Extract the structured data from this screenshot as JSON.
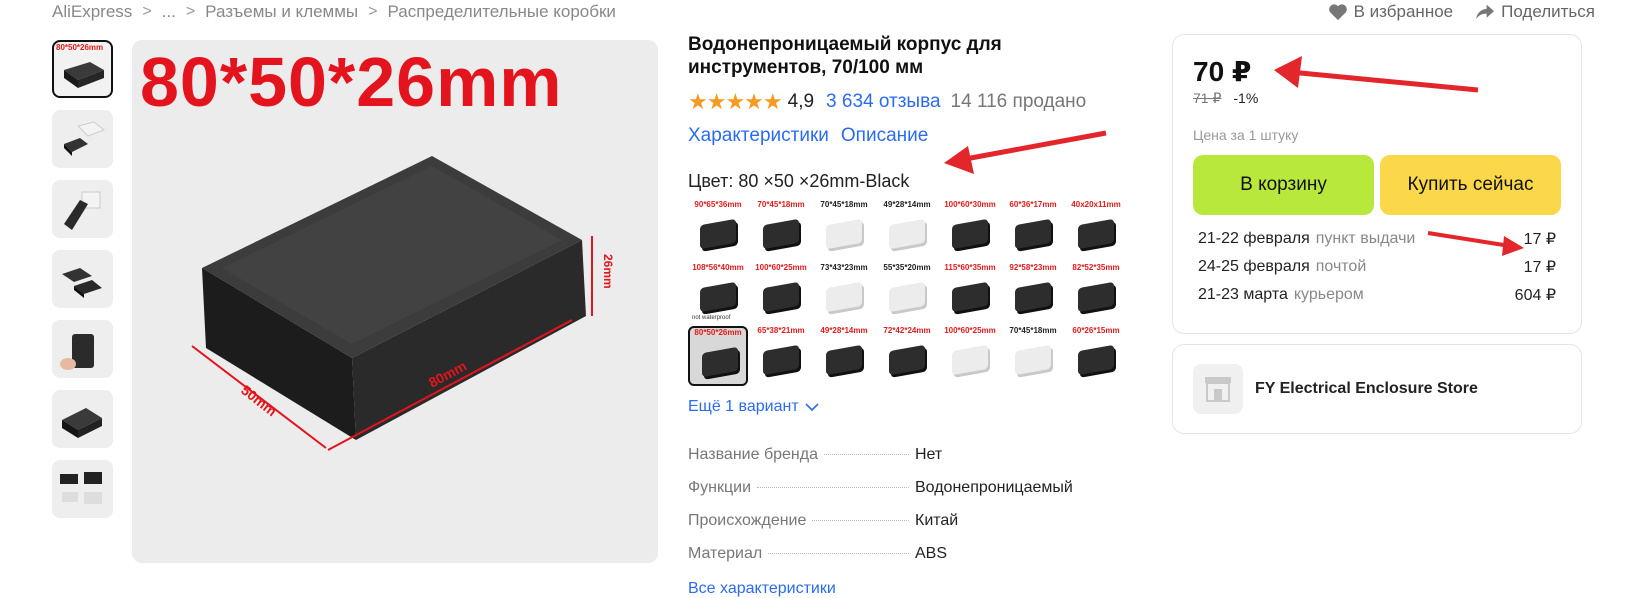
{
  "breadcrumb": {
    "items": [
      "AliExpress",
      "...",
      "Разъемы и клеммы",
      "Распределительные коробки"
    ]
  },
  "top_actions": {
    "favorite": "В избранное",
    "share": "Поделиться"
  },
  "gallery": {
    "main_dims": "80*50*26mm",
    "thumb_label": "80*50*26mm",
    "dim_length": "80mm",
    "dim_width": "50mm",
    "dim_height": "26mm"
  },
  "product": {
    "title": "Водонепроницаемый корпус для инструментов, 70/100 мм",
    "stars": "★★★★★",
    "rating": "4,9",
    "reviews": "3 634 отзыва",
    "sold": "14 116 продано",
    "link_specs": "Характеристики",
    "link_description": "Описание",
    "color_label": "Цвет: 80 ×50 ×26mm-Black",
    "more_variants": "Ещё 1 вариант"
  },
  "variants": [
    {
      "label": "90*65*36mm",
      "red": true,
      "color": "black"
    },
    {
      "label": "70*45*18mm",
      "red": true,
      "color": "black"
    },
    {
      "label": "70*45*18mm",
      "red": false,
      "color": "white"
    },
    {
      "label": "49*28*14mm",
      "red": false,
      "color": "white"
    },
    {
      "label": "100*60*30mm",
      "red": true,
      "color": "black"
    },
    {
      "label": "60*36*17mm",
      "red": true,
      "color": "black"
    },
    {
      "label": "40x20x11mm",
      "red": true,
      "color": "black"
    },
    {
      "label": "108*56*40mm",
      "red": true,
      "color": "black",
      "note": "not waterproof"
    },
    {
      "label": "100*60*25mm",
      "red": true,
      "color": "black"
    },
    {
      "label": "73*43*23mm",
      "red": false,
      "color": "white"
    },
    {
      "label": "55*35*20mm",
      "red": false,
      "color": "white"
    },
    {
      "label": "115*60*35mm",
      "red": true,
      "color": "black"
    },
    {
      "label": "92*58*23mm",
      "red": true,
      "color": "black"
    },
    {
      "label": "82*52*35mm",
      "red": true,
      "color": "black"
    },
    {
      "label": "80*50*26mm",
      "red": true,
      "color": "black",
      "selected": true
    },
    {
      "label": "65*38*21mm",
      "red": true,
      "color": "black"
    },
    {
      "label": "49*28*14mm",
      "red": true,
      "color": "black"
    },
    {
      "label": "72*42*24mm",
      "red": true,
      "color": "black"
    },
    {
      "label": "100*60*25mm",
      "red": true,
      "color": "white"
    },
    {
      "label": "70*45*18mm",
      "red": false,
      "color": "white"
    },
    {
      "label": "60*26*15mm",
      "red": true,
      "color": "black"
    }
  ],
  "specs": [
    {
      "key": "Название бренда",
      "value": "Нет"
    },
    {
      "key": "Функции",
      "value": "Водонепроницаемый"
    },
    {
      "key": "Происхождение",
      "value": "Китай"
    },
    {
      "key": "Материал",
      "value": "ABS"
    }
  ],
  "all_specs": "Все характеристики",
  "buybox": {
    "price": "70 ₽",
    "old_price": "71 ₽",
    "discount": "-1%",
    "per_unit": "Цена за 1 штуку",
    "cart_button": "В корзину",
    "buy_button": "Купить сейчас",
    "delivery": [
      {
        "date": "21-22 февраля",
        "method": "пункт выдачи",
        "price": "17 ₽"
      },
      {
        "date": "24-25 февраля",
        "method": "почтой",
        "price": "17 ₽"
      },
      {
        "date": "21-23 марта",
        "method": "курьером",
        "price": "604 ₽"
      }
    ]
  },
  "store": {
    "name": "FY Electrical Enclosure Store"
  },
  "colors": {
    "accent_blue": "#2a6bf0",
    "star": "#f59a23",
    "cart_green": "#b9e83c",
    "buy_yellow": "#fbd84a",
    "annotation_red": "#e3262b"
  }
}
